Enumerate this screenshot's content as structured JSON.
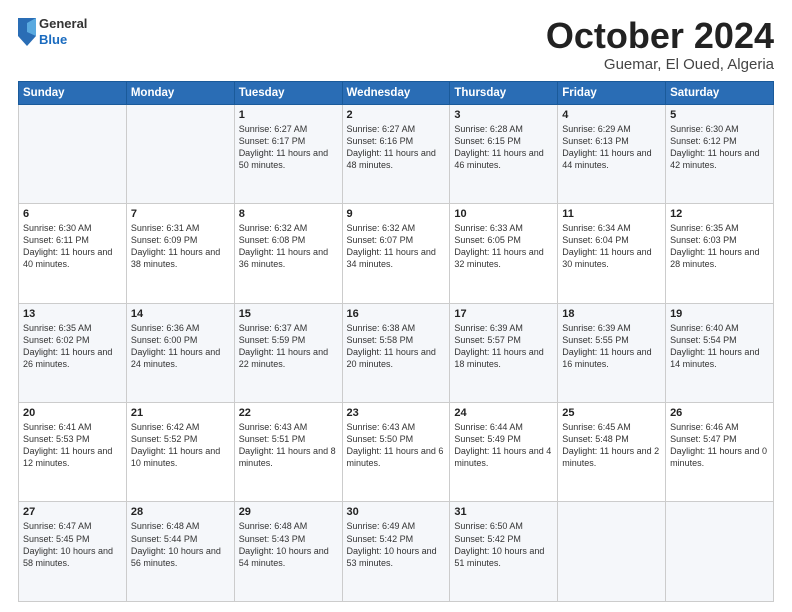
{
  "logo": {
    "general": "General",
    "blue": "Blue"
  },
  "header": {
    "month": "October 2024",
    "location": "Guemar, El Oued, Algeria"
  },
  "weekdays": [
    "Sunday",
    "Monday",
    "Tuesday",
    "Wednesday",
    "Thursday",
    "Friday",
    "Saturday"
  ],
  "weeks": [
    [
      {
        "day": "",
        "detail": ""
      },
      {
        "day": "",
        "detail": ""
      },
      {
        "day": "1",
        "detail": "Sunrise: 6:27 AM\nSunset: 6:17 PM\nDaylight: 11 hours and 50 minutes."
      },
      {
        "day": "2",
        "detail": "Sunrise: 6:27 AM\nSunset: 6:16 PM\nDaylight: 11 hours and 48 minutes."
      },
      {
        "day": "3",
        "detail": "Sunrise: 6:28 AM\nSunset: 6:15 PM\nDaylight: 11 hours and 46 minutes."
      },
      {
        "day": "4",
        "detail": "Sunrise: 6:29 AM\nSunset: 6:13 PM\nDaylight: 11 hours and 44 minutes."
      },
      {
        "day": "5",
        "detail": "Sunrise: 6:30 AM\nSunset: 6:12 PM\nDaylight: 11 hours and 42 minutes."
      }
    ],
    [
      {
        "day": "6",
        "detail": "Sunrise: 6:30 AM\nSunset: 6:11 PM\nDaylight: 11 hours and 40 minutes."
      },
      {
        "day": "7",
        "detail": "Sunrise: 6:31 AM\nSunset: 6:09 PM\nDaylight: 11 hours and 38 minutes."
      },
      {
        "day": "8",
        "detail": "Sunrise: 6:32 AM\nSunset: 6:08 PM\nDaylight: 11 hours and 36 minutes."
      },
      {
        "day": "9",
        "detail": "Sunrise: 6:32 AM\nSunset: 6:07 PM\nDaylight: 11 hours and 34 minutes."
      },
      {
        "day": "10",
        "detail": "Sunrise: 6:33 AM\nSunset: 6:05 PM\nDaylight: 11 hours and 32 minutes."
      },
      {
        "day": "11",
        "detail": "Sunrise: 6:34 AM\nSunset: 6:04 PM\nDaylight: 11 hours and 30 minutes."
      },
      {
        "day": "12",
        "detail": "Sunrise: 6:35 AM\nSunset: 6:03 PM\nDaylight: 11 hours and 28 minutes."
      }
    ],
    [
      {
        "day": "13",
        "detail": "Sunrise: 6:35 AM\nSunset: 6:02 PM\nDaylight: 11 hours and 26 minutes."
      },
      {
        "day": "14",
        "detail": "Sunrise: 6:36 AM\nSunset: 6:00 PM\nDaylight: 11 hours and 24 minutes."
      },
      {
        "day": "15",
        "detail": "Sunrise: 6:37 AM\nSunset: 5:59 PM\nDaylight: 11 hours and 22 minutes."
      },
      {
        "day": "16",
        "detail": "Sunrise: 6:38 AM\nSunset: 5:58 PM\nDaylight: 11 hours and 20 minutes."
      },
      {
        "day": "17",
        "detail": "Sunrise: 6:39 AM\nSunset: 5:57 PM\nDaylight: 11 hours and 18 minutes."
      },
      {
        "day": "18",
        "detail": "Sunrise: 6:39 AM\nSunset: 5:55 PM\nDaylight: 11 hours and 16 minutes."
      },
      {
        "day": "19",
        "detail": "Sunrise: 6:40 AM\nSunset: 5:54 PM\nDaylight: 11 hours and 14 minutes."
      }
    ],
    [
      {
        "day": "20",
        "detail": "Sunrise: 6:41 AM\nSunset: 5:53 PM\nDaylight: 11 hours and 12 minutes."
      },
      {
        "day": "21",
        "detail": "Sunrise: 6:42 AM\nSunset: 5:52 PM\nDaylight: 11 hours and 10 minutes."
      },
      {
        "day": "22",
        "detail": "Sunrise: 6:43 AM\nSunset: 5:51 PM\nDaylight: 11 hours and 8 minutes."
      },
      {
        "day": "23",
        "detail": "Sunrise: 6:43 AM\nSunset: 5:50 PM\nDaylight: 11 hours and 6 minutes."
      },
      {
        "day": "24",
        "detail": "Sunrise: 6:44 AM\nSunset: 5:49 PM\nDaylight: 11 hours and 4 minutes."
      },
      {
        "day": "25",
        "detail": "Sunrise: 6:45 AM\nSunset: 5:48 PM\nDaylight: 11 hours and 2 minutes."
      },
      {
        "day": "26",
        "detail": "Sunrise: 6:46 AM\nSunset: 5:47 PM\nDaylight: 11 hours and 0 minutes."
      }
    ],
    [
      {
        "day": "27",
        "detail": "Sunrise: 6:47 AM\nSunset: 5:45 PM\nDaylight: 10 hours and 58 minutes."
      },
      {
        "day": "28",
        "detail": "Sunrise: 6:48 AM\nSunset: 5:44 PM\nDaylight: 10 hours and 56 minutes."
      },
      {
        "day": "29",
        "detail": "Sunrise: 6:48 AM\nSunset: 5:43 PM\nDaylight: 10 hours and 54 minutes."
      },
      {
        "day": "30",
        "detail": "Sunrise: 6:49 AM\nSunset: 5:42 PM\nDaylight: 10 hours and 53 minutes."
      },
      {
        "day": "31",
        "detail": "Sunrise: 6:50 AM\nSunset: 5:42 PM\nDaylight: 10 hours and 51 minutes."
      },
      {
        "day": "",
        "detail": ""
      },
      {
        "day": "",
        "detail": ""
      }
    ]
  ]
}
